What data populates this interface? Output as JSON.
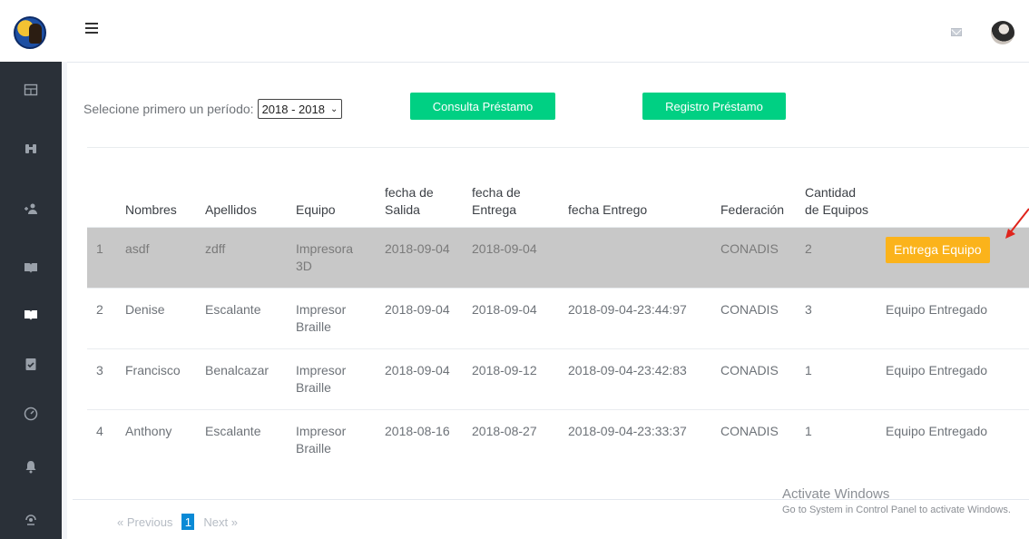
{
  "header": {
    "menu_icon": "hamburger-icon",
    "mail_icon": "mail-icon",
    "avatar": "user-avatar"
  },
  "sidebar": {
    "icons": [
      "table-icon",
      "binoculars-icon",
      "add-user-icon",
      "book-open-icon",
      "book-open-icon",
      "clipboard-check-icon",
      "speedometer-icon",
      "bell-icon",
      "support-icon"
    ]
  },
  "filter": {
    "label": "Selecione primero un período:",
    "period_value": "2018 - 2018"
  },
  "actions": {
    "consulta_label": "Consulta Préstamo",
    "registro_label": "Registro Préstamo"
  },
  "table": {
    "headers": {
      "nombres": "Nombres",
      "apellidos": "Apellidos",
      "equipo": "Equipo",
      "salida": "fecha de Salida",
      "entrega": "fecha de Entrega",
      "entrego": "fecha Entrego",
      "federacion": "Federación",
      "cantidad": "Cantidad de Equipos"
    },
    "rows": [
      {
        "n": "1",
        "nombres": "asdf",
        "apellidos": "zdff",
        "equipo": "Impresora 3D",
        "salida": "2018-09-04",
        "entrega": "2018-09-04",
        "entrego": "",
        "federacion": "CONADIS",
        "cantidad": "2",
        "accion": "Entrega Equipo"
      },
      {
        "n": "2",
        "nombres": "Denise",
        "apellidos": "Escalante",
        "equipo": "Impresor Braille",
        "salida": "2018-09-04",
        "entrega": "2018-09-04",
        "entrego": "2018-09-04-23:44:97",
        "federacion": "CONADIS",
        "cantidad": "3",
        "accion": "Equipo Entregado"
      },
      {
        "n": "3",
        "nombres": "Francisco",
        "apellidos": "Benalcazar",
        "equipo": "Impresor Braille",
        "salida": "2018-09-04",
        "entrega": "2018-09-12",
        "entrego": "2018-09-04-23:42:83",
        "federacion": "CONADIS",
        "cantidad": "1",
        "accion": "Equipo Entregado"
      },
      {
        "n": "4",
        "nombres": "Anthony",
        "apellidos": "Escalante",
        "equipo": "Impresor Braille",
        "salida": "2018-08-16",
        "entrega": "2018-08-27",
        "entrego": "2018-09-04-23:33:37",
        "federacion": "CONADIS",
        "cantidad": "1",
        "accion": "Equipo Entregado"
      }
    ]
  },
  "pagination": {
    "previous": "« Previous",
    "current": "1",
    "next": "Next »"
  },
  "watermark": {
    "title": "Activate Windows",
    "subtitle": "Go to System in Control Panel to activate Windows."
  },
  "colors": {
    "accent_green": "#00d083",
    "accent_orange": "#fbb31b",
    "sidebar_bg": "#2a3038",
    "pager_active": "#0a8ad6"
  }
}
